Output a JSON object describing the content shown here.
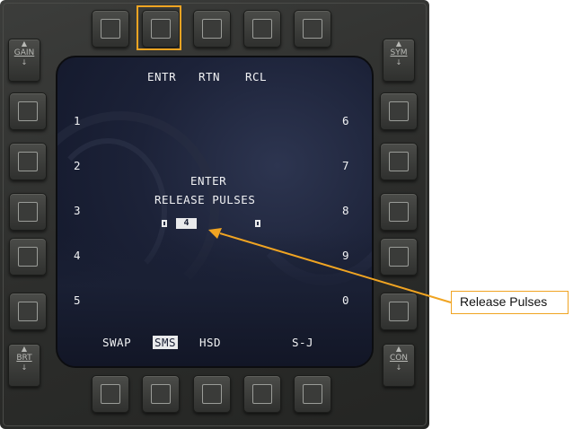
{
  "mfd": {
    "top_labels": [
      "ENTR",
      "RTN",
      "RCL"
    ],
    "left_numbers": [
      "1",
      "2",
      "3",
      "4",
      "5"
    ],
    "right_numbers": [
      "6",
      "7",
      "8",
      "9",
      "0"
    ],
    "prompt_line1": "ENTER",
    "prompt_line2": "RELEASE PULSES",
    "release_pulses_value": "4",
    "bottom_labels": {
      "swap": "SWAP",
      "sms": "SMS",
      "hsd": "HSD",
      "sj": "S-J"
    },
    "rockers": {
      "gain": "GAIN",
      "sym": "SYM",
      "brt": "BRT",
      "con": "CON"
    }
  },
  "annotation": {
    "callout_text": "Release Pulses",
    "accent_color": "#f0a422"
  }
}
